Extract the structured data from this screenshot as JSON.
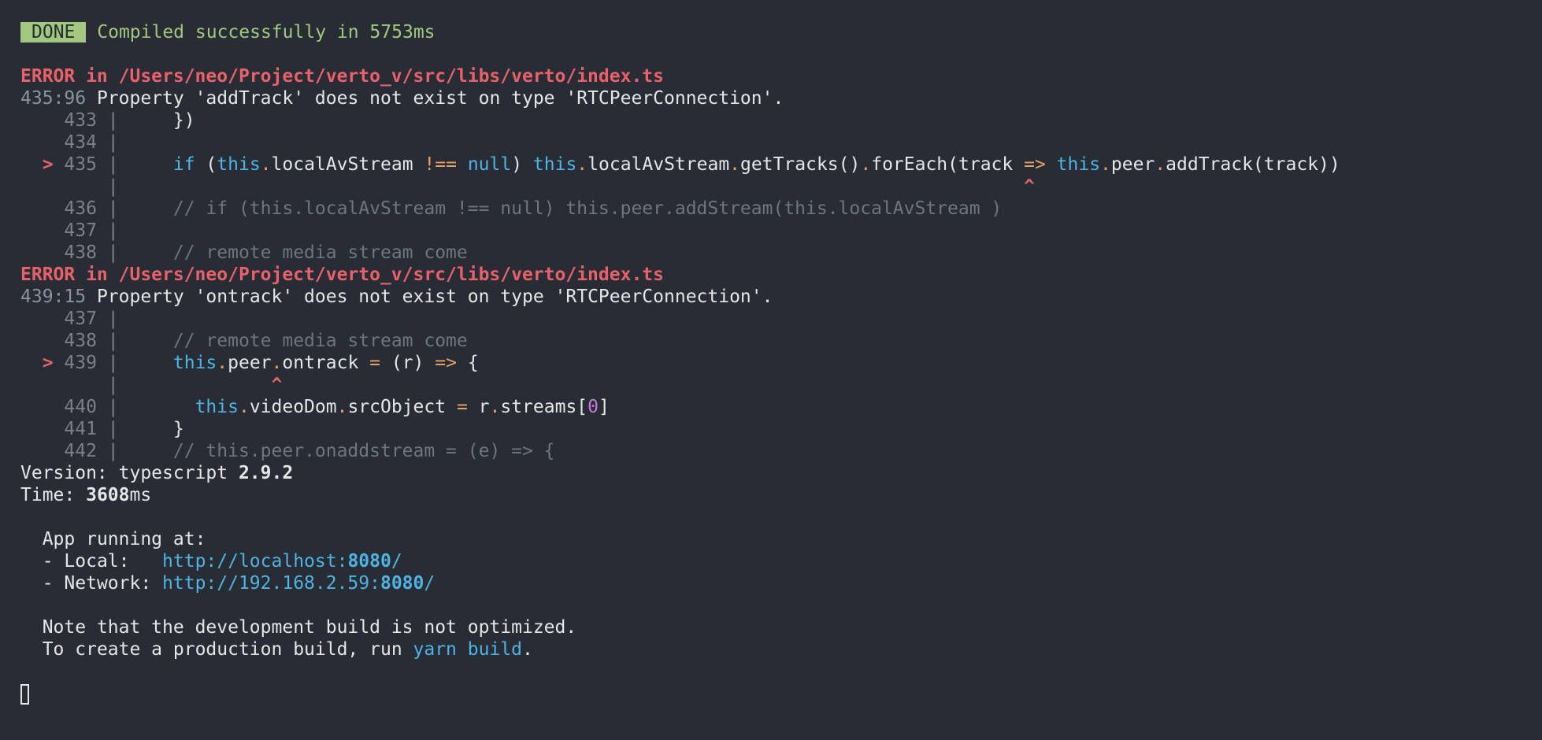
{
  "build": {
    "badge": "DONE",
    "message": "Compiled successfully in 5753ms"
  },
  "errors": [
    {
      "header": "ERROR in /Users/neo/Project/verto_v/src/libs/verto/index.ts",
      "location": "435:96",
      "message": "Property 'addTrack' does not exist on type 'RTCPeerConnection'.",
      "lines": [
        {
          "num": "433",
          "gutter": "  ",
          "code": "    })"
        },
        {
          "num": "434",
          "gutter": "  ",
          "code": ""
        },
        {
          "num": "435",
          "gutter": "> ",
          "code": "    if (this.localAvStream !== null) this.localAvStream.getTracks().forEach(track => this.peer.addTrack(track))"
        },
        {
          "caret": "^"
        },
        {
          "num": "436",
          "gutter": "  ",
          "code": "    // if (this.localAvStream !== null) this.peer.addStream(this.localAvStream )"
        },
        {
          "num": "437",
          "gutter": "  ",
          "code": ""
        },
        {
          "num": "438",
          "gutter": "  ",
          "code": "    // remote media stream come"
        }
      ]
    },
    {
      "header": "ERROR in /Users/neo/Project/verto_v/src/libs/verto/index.ts",
      "location": "439:15",
      "message": "Property 'ontrack' does not exist on type 'RTCPeerConnection'.",
      "lines": [
        {
          "num": "437",
          "gutter": "  ",
          "code": ""
        },
        {
          "num": "438",
          "gutter": "  ",
          "code": "    // remote media stream come"
        },
        {
          "num": "439",
          "gutter": "> ",
          "code": "    this.peer.ontrack = (r) => {"
        },
        {
          "caret": "^"
        },
        {
          "num": "440",
          "gutter": "  ",
          "code": "      this.videoDom.srcObject = r.streams[0]"
        },
        {
          "num": "441",
          "gutter": "  ",
          "code": "    }"
        },
        {
          "num": "442",
          "gutter": "  ",
          "code": "    // this.peer.onaddstream = (e) => {"
        }
      ]
    }
  ],
  "version": {
    "label": "Version: typescript ",
    "value": "2.9.2"
  },
  "time": {
    "label": "Time: ",
    "value": "3608",
    "unit": "ms"
  },
  "app": {
    "running_label": "App running at:",
    "local_label": "- Local:   ",
    "local_url_prefix": "http://localhost:",
    "local_port": "8080",
    "local_url_suffix": "/",
    "network_label": "- Network: ",
    "network_url_prefix": "http://192.168.2.59:",
    "network_port": "8080",
    "network_url_suffix": "/"
  },
  "note": {
    "line1": "Note that the development build is not optimized.",
    "line2_prefix": "To create a production build, run ",
    "command": "yarn build",
    "line2_suffix": "."
  },
  "colors": {
    "background": "#282c34",
    "success": "#a2c880",
    "error": "#e8616b",
    "keyword": "#4fb3e3",
    "operator": "#e5a268",
    "number": "#c678dd"
  },
  "icons": {
    "cursor": "block-cursor-icon"
  }
}
